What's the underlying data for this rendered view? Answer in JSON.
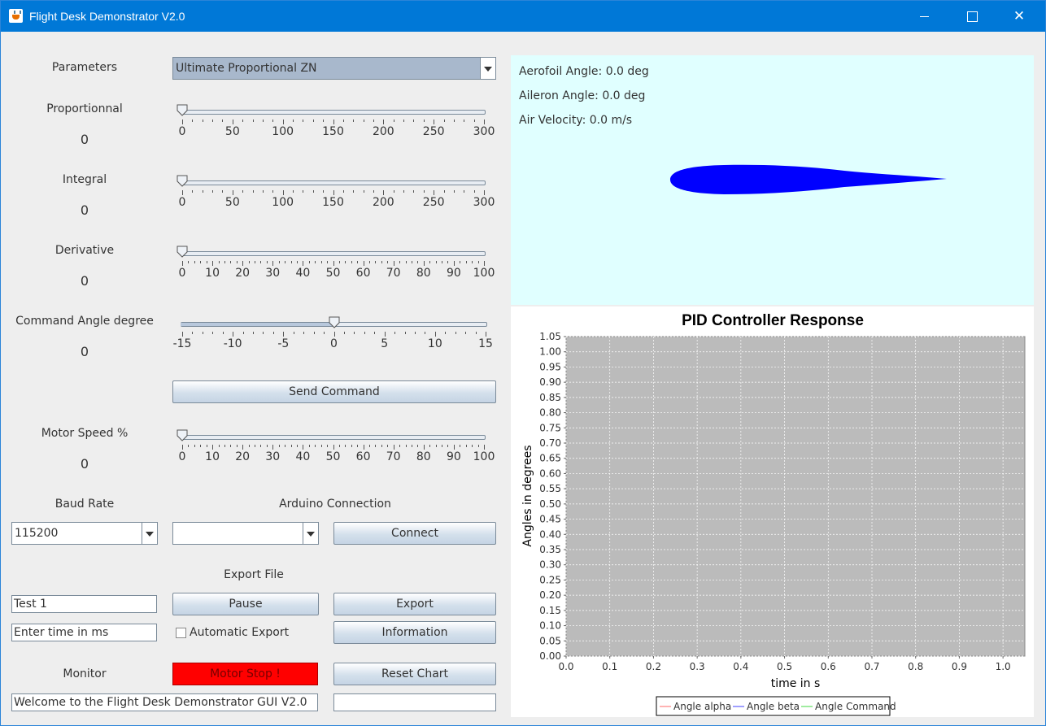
{
  "window": {
    "title": "Flight Desk Demonstrator V2.0"
  },
  "params": {
    "label": "Parameters",
    "selected": "Ultimate Proportional ZN"
  },
  "sliders": [
    {
      "label": "Proportionnal",
      "value": "0",
      "pos": 0.0,
      "ticks": [
        "0",
        "50",
        "100",
        "150",
        "200",
        "250",
        "300"
      ]
    },
    {
      "label": "Integral",
      "value": "0",
      "pos": 0.0,
      "ticks": [
        "0",
        "50",
        "100",
        "150",
        "200",
        "250",
        "300"
      ]
    },
    {
      "label": "Derivative",
      "value": "0",
      "pos": 0.0,
      "ticks": [
        "0",
        "10",
        "20",
        "30",
        "40",
        "50",
        "60",
        "70",
        "80",
        "90",
        "100"
      ]
    },
    {
      "label": "Command Angle degree",
      "value": "0",
      "pos": 0.5,
      "ticks": [
        "-15",
        "-10",
        "-5",
        "0",
        "5",
        "10",
        "15"
      ]
    },
    {
      "label": "Motor Speed %",
      "value": "0",
      "pos": 0.0,
      "ticks": [
        "0",
        "10",
        "20",
        "30",
        "40",
        "50",
        "60",
        "70",
        "80",
        "90",
        "100"
      ]
    }
  ],
  "send_command": "Send Command",
  "connection": {
    "baud_label": "Baud Rate",
    "baud_value": "115200",
    "arduino_label": "Arduino Connection",
    "arduino_value": "",
    "connect": "Connect"
  },
  "export": {
    "label": "Export File",
    "file_name": "Test 1",
    "time_placeholder": "Enter time in ms",
    "pause": "Pause",
    "export": "Export",
    "auto_export": "Automatic Export",
    "information": "Information"
  },
  "monitor": {
    "label": "Monitor",
    "motor_stop": "Motor Stop !",
    "reset_chart": "Reset Chart",
    "message": "Welcome to the Flight Desk Demonstrator GUI V2.0",
    "extra": ""
  },
  "aerofoil": {
    "aerofoil_angle": "Aerofoil Angle: 0.0 deg",
    "aileron_angle": "Aileron Angle: 0.0 deg",
    "air_velocity": "Air Velocity: 0.0 m/s",
    "color": "#0000ff",
    "bg": "#e0ffff"
  },
  "chart_data": {
    "type": "line",
    "title": "PID Controller Response",
    "xlabel": "time in s",
    "ylabel": "Angles in degrees",
    "xlim": [
      0.0,
      1.05
    ],
    "ylim": [
      0.0,
      1.05
    ],
    "xticks": [
      "0.0",
      "0.1",
      "0.2",
      "0.3",
      "0.4",
      "0.5",
      "0.6",
      "0.7",
      "0.8",
      "0.9",
      "1.0"
    ],
    "yticks": [
      "0.00",
      "0.05",
      "0.10",
      "0.15",
      "0.20",
      "0.25",
      "0.30",
      "0.35",
      "0.40",
      "0.45",
      "0.50",
      "0.55",
      "0.60",
      "0.65",
      "0.70",
      "0.75",
      "0.80",
      "0.85",
      "0.90",
      "0.95",
      "1.00",
      "1.05"
    ],
    "grid": true,
    "plot_bg": "#bbbbbb",
    "legend_position": "bottom",
    "series": [
      {
        "name": "Angle alpha",
        "color": "#ff8080",
        "x": [],
        "y": []
      },
      {
        "name": "Angle beta",
        "color": "#6060ff",
        "x": [],
        "y": []
      },
      {
        "name": "Angle Command",
        "color": "#60e060",
        "x": [],
        "y": []
      }
    ]
  }
}
